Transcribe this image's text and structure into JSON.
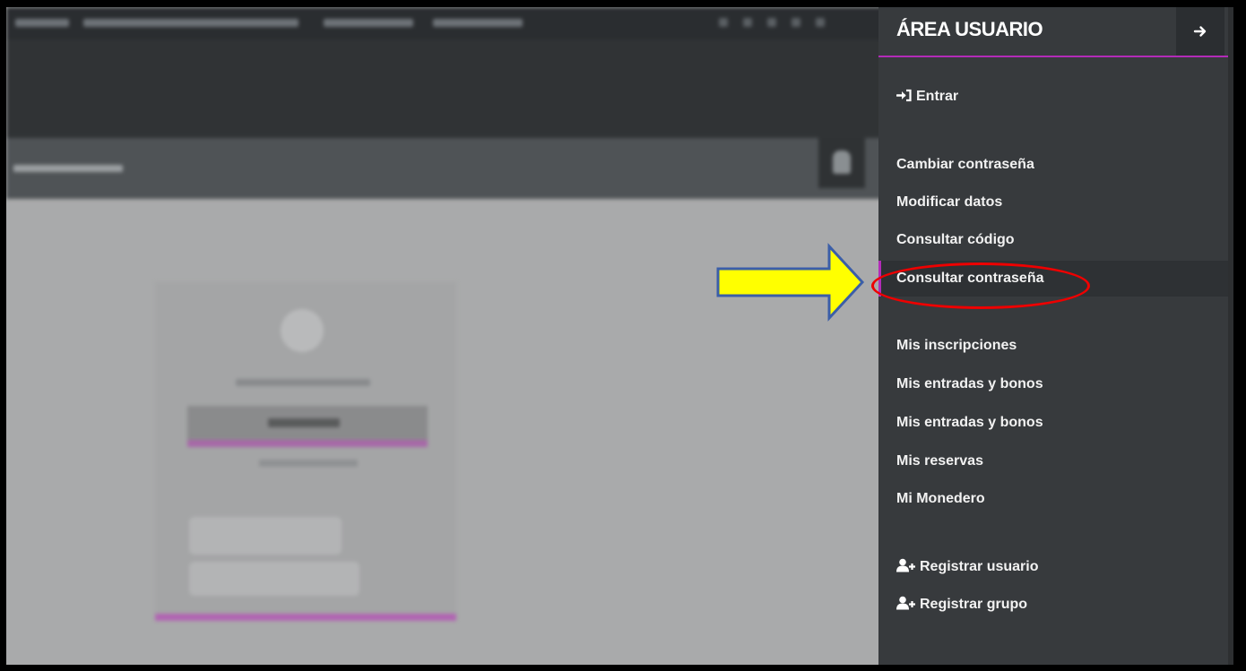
{
  "panel": {
    "title": "ÁREA USUARIO",
    "close_icon": "arrow-right-icon",
    "login": {
      "label": "Entrar",
      "icon": "sign-in-icon"
    },
    "account_links": [
      {
        "label": "Cambiar contraseña"
      },
      {
        "label": "Modificar datos"
      },
      {
        "label": "Consultar código"
      },
      {
        "label": "Consultar contraseña",
        "active": true
      }
    ],
    "user_links": [
      {
        "label": "Mis inscripciones"
      },
      {
        "label": "Mis entradas y bonos"
      },
      {
        "label": "Mis entradas y bonos"
      },
      {
        "label": "Mis reservas"
      },
      {
        "label": "Mi Monedero"
      }
    ],
    "register_links": [
      {
        "label": "Registrar usuario",
        "icon": "user-plus-icon"
      },
      {
        "label": "Registrar grupo",
        "icon": "user-plus-icon"
      }
    ]
  },
  "colors": {
    "accent": "#b32bb8",
    "panel_bg": "#373a3d",
    "annotation_arrow": "#ffff00",
    "annotation_ring": "#e00000"
  }
}
